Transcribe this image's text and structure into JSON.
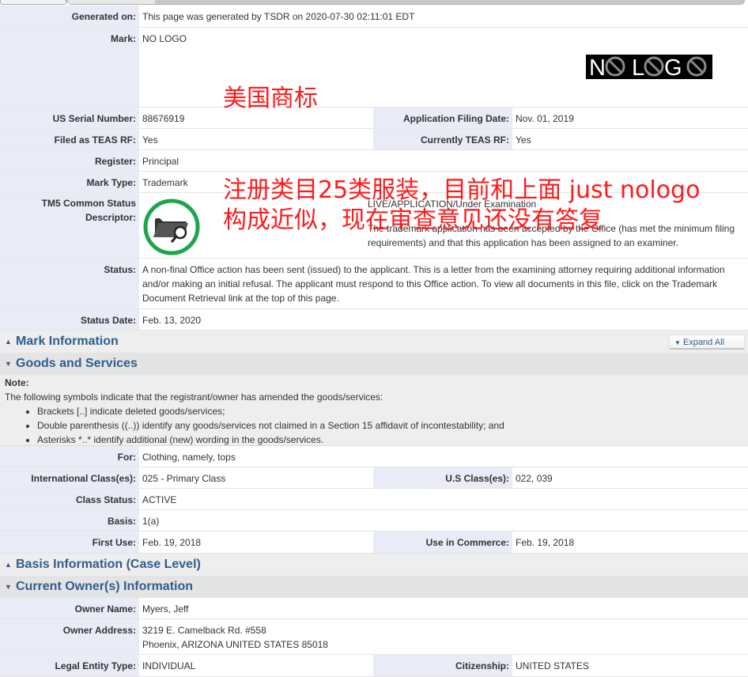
{
  "page": {
    "generated_on": {
      "label": "Generated on:",
      "value": "This page was generated by TSDR on 2020-07-30 02:11:01 EDT"
    },
    "mark": {
      "label": "Mark:",
      "value": "NO LOGO",
      "image_text": "NO LOGO"
    },
    "serial": {
      "label": "US Serial Number:",
      "value": "88676919"
    },
    "filing_date": {
      "label": "Application Filing Date:",
      "value": "Nov. 01, 2019"
    },
    "teas_filed": {
      "label": "Filed as TEAS RF:",
      "value": "Yes"
    },
    "teas_current": {
      "label": "Currently TEAS RF:",
      "value": "Yes"
    },
    "register": {
      "label": "Register:",
      "value": "Principal"
    },
    "mark_type": {
      "label": "Mark Type:",
      "value": "Trademark"
    },
    "tm5": {
      "label_line1": "TM5 Common Status",
      "label_line2": "Descriptor:",
      "icon": "folder-search-icon",
      "status_line": "LIVE/APPLICATION/Under Examination",
      "description": "The trademark application has been accepted by the Office (has met the minimum filing requirements) and that this application has been assigned to an examiner."
    },
    "status": {
      "label": "Status:",
      "value": "A non-final Office action has been sent (issued) to the applicant. This is a letter from the examining attorney requiring additional information and/or making an initial refusal. The applicant must respond to this Office action. To view all documents in this file, click on the Trademark Document Retrieval link at the top of this page."
    },
    "status_date": {
      "label": "Status Date:",
      "value": "Feb. 13, 2020"
    }
  },
  "sections": {
    "mark_info": {
      "title": "Mark Information",
      "state": "collapsed"
    },
    "goods": {
      "title": "Goods and Services",
      "state": "expanded"
    },
    "basis": {
      "title": "Basis Information (Case Level)",
      "state": "collapsed"
    },
    "owner": {
      "title": "Current Owner(s) Information",
      "state": "expanded"
    },
    "expand_all": "Expand All"
  },
  "note": {
    "heading": "Note:",
    "intro": "The following symbols indicate that the registrant/owner has amended the goods/services:",
    "items": [
      "Brackets [..] indicate deleted goods/services;",
      "Double parenthesis ((..)) identify any goods/services not claimed in a Section 15 affidavit of incontestability; and",
      "Asterisks *..* identify additional (new) wording in the goods/services."
    ]
  },
  "goods": {
    "for": {
      "label": "For:",
      "value": "Clothing, namely, tops"
    },
    "intl_class": {
      "label": "International Class(es):",
      "value": "025 - Primary Class"
    },
    "us_class": {
      "label": "U.S Class(es):",
      "value": "022, 039"
    },
    "class_status": {
      "label": "Class Status:",
      "value": "ACTIVE"
    },
    "basis": {
      "label": "Basis:",
      "value": "1(a)"
    },
    "first_use": {
      "label": "First Use:",
      "value": "Feb. 19, 2018"
    },
    "use_commerce": {
      "label": "Use in Commerce:",
      "value": "Feb. 19, 2018"
    }
  },
  "owner": {
    "name": {
      "label": "Owner Name:",
      "value": "Myers, Jeff"
    },
    "address": {
      "label": "Owner Address:",
      "line1": "3219 E. Camelback Rd. #558",
      "line2": "Phoenix, ARIZONA UNITED STATES 85018"
    },
    "entity": {
      "label": "Legal Entity Type:",
      "value": "INDIVIDUAL"
    },
    "citizenship": {
      "label": "Citizenship:",
      "value": "UNITED STATES"
    }
  },
  "annotations": {
    "note1": "美国商标",
    "note2_line1": "注册类目25类服装，目前和上面 just nologo",
    "note2_line2": "构成近似，现在审查意见还没有答复",
    "color": "#ff1a1a"
  }
}
